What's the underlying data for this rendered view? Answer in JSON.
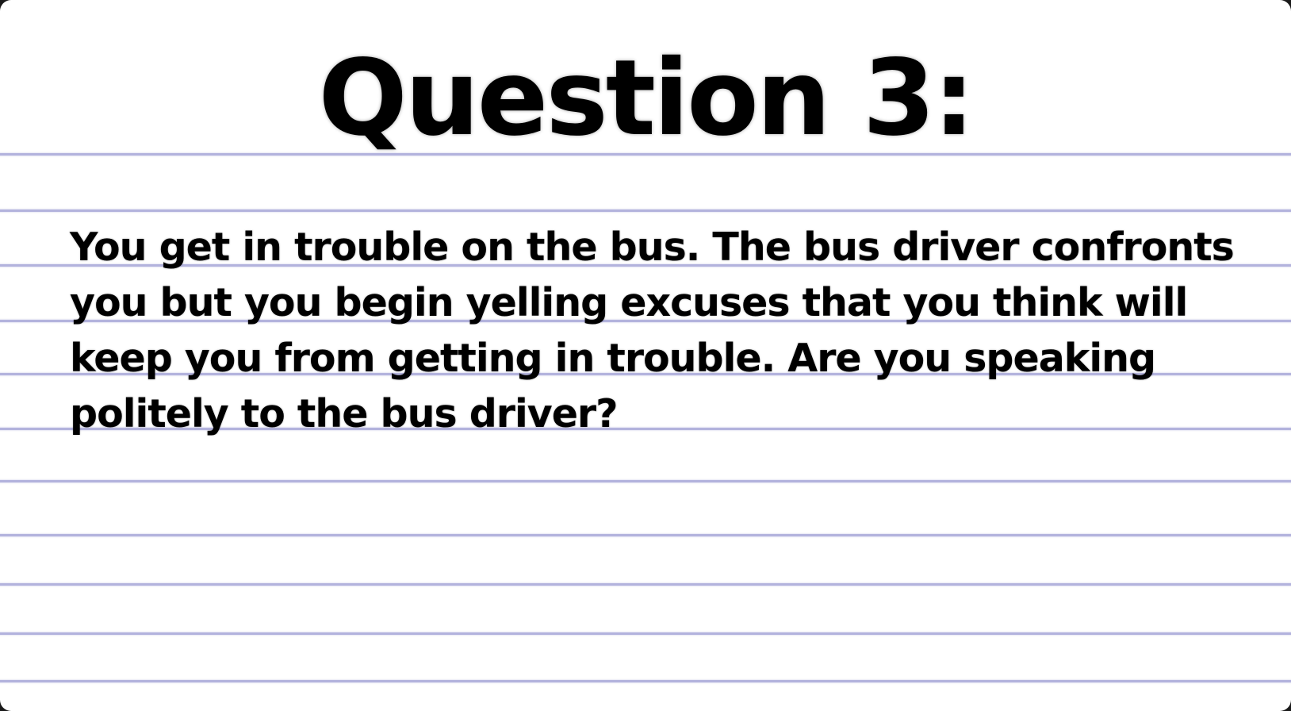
{
  "slide": {
    "title": "Question 3:",
    "body": "You get in trouble on the bus. The bus driver confronts you but you begin yelling excuses that you think will keep you from getting in trouble. Are you speaking politely to the bus driver?"
  },
  "colors": {
    "paper": "#ffffff",
    "rule_line": "#b3b3dd",
    "text": "#000000",
    "frame": "#1a1a1a"
  }
}
